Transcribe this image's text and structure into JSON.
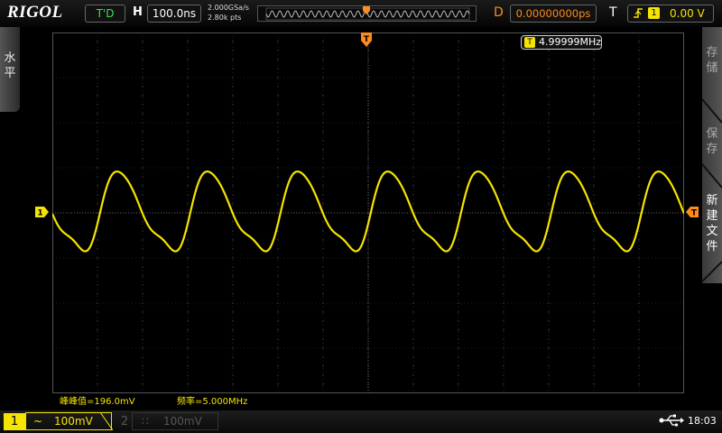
{
  "brand": "RIGOL",
  "top": {
    "run_state": "T'D",
    "horizontal_label": "H",
    "timebase": "100.0ns",
    "sample_rate": "2.000GSa/s",
    "memory_depth": "2.80k pts",
    "delay_label": "D",
    "delay_value": "0.00000000ps",
    "trigger_label": "T",
    "trigger_source": "1",
    "trigger_level": "0.00 V"
  },
  "left_tab": {
    "label_line1": "水",
    "label_line2": "平"
  },
  "right_menu": {
    "item1_line1": "存",
    "item1_line2": "储",
    "item2_line1": "保",
    "item2_line2": "存",
    "item3_line1": "新",
    "item3_line2": "建",
    "item3_line3": "文",
    "item3_line4": "件"
  },
  "screen": {
    "frequency_counter": "4.99999MHz",
    "counter_badge": "T",
    "ch1_marker": "1",
    "trigger_marker": "T"
  },
  "measurements": {
    "vpp": "峰峰值=196.0mV",
    "freq": "频率=5.000MHz"
  },
  "bottom": {
    "ch1_num": "1",
    "ch1_coupling": "~",
    "ch1_scale": "100mV",
    "ch2_num": "2",
    "ch2_coupling": "∷",
    "ch2_scale": "100mV",
    "usb": "⭠⭢",
    "clock": "18:03"
  },
  "colors": {
    "ch1": "#f5e400",
    "trigger": "#ff8c1a",
    "grid": "#3c3c3c"
  },
  "chart_data": {
    "type": "line",
    "series": [
      {
        "name": "",
        "waveform": "distorted-sine",
        "frequency_mhz": 5.0,
        "vpp_mv": 196.0
      }
    ],
    "xlim_ns": [
      -700,
      700
    ],
    "ylim_mv": [
      -400,
      400
    ],
    "grid": true
  }
}
